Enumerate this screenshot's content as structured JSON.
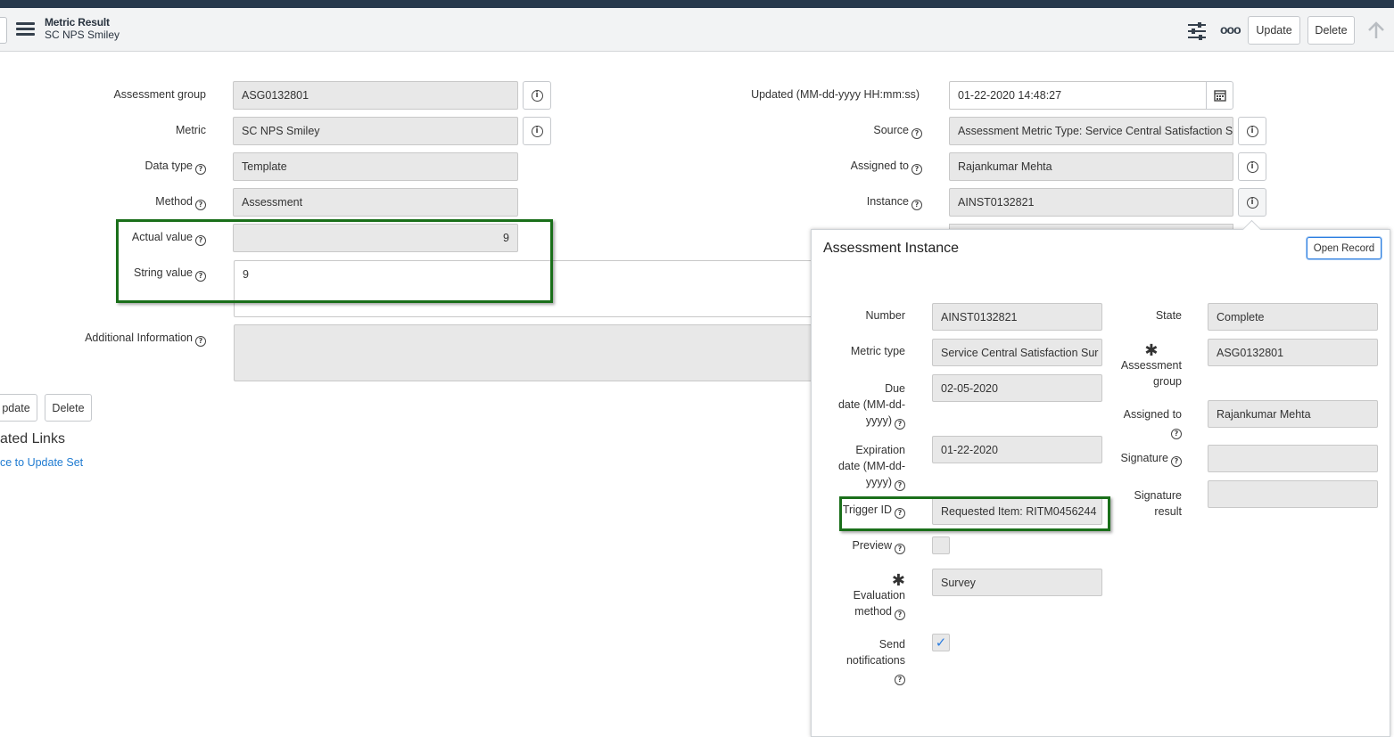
{
  "header": {
    "title": "Metric Result",
    "subtitle": "SC NPS Smiley",
    "update_label": "Update",
    "delete_label": "Delete",
    "more_label": "ooo"
  },
  "form": {
    "assessment_group_label": "Assessment group",
    "assessment_group_value": "ASG0132801",
    "metric_label": "Metric",
    "metric_value": "SC NPS Smiley",
    "data_type_label": "Data type",
    "data_type_value": "Template",
    "method_label": "Method",
    "method_value": "Assessment",
    "actual_value_label": "Actual value",
    "actual_value_value": "9",
    "string_value_label": "String value",
    "string_value_value": "9",
    "additional_info_label": "Additional Information",
    "updated_label": "Updated (MM-dd-yyyy HH:mm:ss)",
    "updated_value": "01-22-2020 14:48:27",
    "source_label": "Source",
    "source_value": "Assessment Metric Type: Service Central Satisfaction Sur",
    "assigned_to_label": "Assigned to",
    "assigned_to_value": "Rajankumar Mehta",
    "instance_label": "Instance",
    "instance_value": "AINST0132821"
  },
  "footer": {
    "update_label": "pdate",
    "delete_label": "Delete",
    "related_links_title": "ated Links",
    "update_set_link": "ce to Update Set"
  },
  "popup": {
    "title": "Assessment Instance",
    "open_record_label": "Open Record",
    "number_label": "Number",
    "number_value": "AINST0132821",
    "metric_type_label": "Metric type",
    "metric_type_value": "Service Central Satisfaction Sur",
    "due_date_label_1": "Due",
    "due_date_label_2": "date (MM-dd-",
    "due_date_label_3": "yyyy)",
    "due_date_value": "02-05-2020",
    "expiration_label_1": "Expiration",
    "expiration_label_2": "date (MM-dd-",
    "expiration_label_3": "yyyy)",
    "expiration_value": "01-22-2020",
    "trigger_id_label": "Trigger ID",
    "trigger_id_value": "Requested Item: RITM0456244",
    "preview_label": "Preview",
    "eval_method_label_1": "Evaluation",
    "eval_method_label_2": "method",
    "eval_method_value": "Survey",
    "send_notif_label_1": "Send",
    "send_notif_label_2": "notifications",
    "state_label": "State",
    "state_value": "Complete",
    "assessment_group_label_1": "Assessment",
    "assessment_group_label_2": "group",
    "assessment_group_value": "ASG0132801",
    "assigned_to_label_1": "Assigned to",
    "assigned_to_value": "Rajankumar Mehta",
    "signature_label": "Signature",
    "signature_result_label_1": "Signature",
    "signature_result_label_2": "result"
  },
  "icons": {
    "info": "i",
    "help": "?",
    "required": "✱",
    "check": "✓"
  },
  "colors": {
    "header_bg": "#f2f3f4",
    "top_strip": "#27384c",
    "highlight_box": "#1a6f1a",
    "link": "#1f7bd1"
  }
}
